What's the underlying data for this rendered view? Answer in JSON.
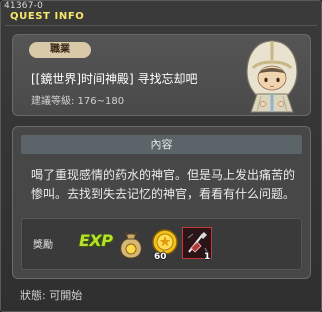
{
  "window": {
    "code": "41367-0",
    "title": "QUEST INFO"
  },
  "info": {
    "job_label": "職業",
    "quest_name": "[[鏡世界]时间神殿] 寻找忘却吧",
    "recommend_level": "建議等級: 176~180",
    "npc_icon": "hooded-priest-npc-icon"
  },
  "content": {
    "header": "內容",
    "description": "喝了重现感情的药水的神官。但是马上发出痛苦的惨叫。去找到失去记忆的神官，看看有什么问题。"
  },
  "reward": {
    "label": "獎勵",
    "exp_label": "EXP",
    "items": [
      {
        "icon": "meso-bag-icon"
      },
      {
        "icon": "gold-coin-icon",
        "count": "60"
      },
      {
        "icon": "red-scroll-item-icon",
        "count": "1"
      }
    ]
  },
  "status": {
    "text": "狀態:  可開始"
  },
  "colors": {
    "title_yellow": "#f7e76a",
    "exp_green": "#b6e22a",
    "panel_gray": "#474747",
    "header_bar": "#5b6468",
    "job_badge": "#d9c9a8"
  }
}
